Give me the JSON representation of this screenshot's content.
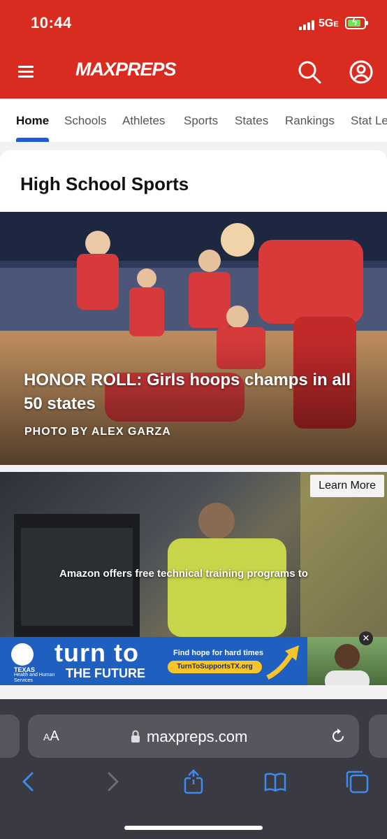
{
  "status_bar": {
    "time": "10:44",
    "network": "5G",
    "network_suffix": "E"
  },
  "app_header": {
    "logo_text": "MAXPREPS",
    "brand_color": "#d92c20",
    "menu_icon": "hamburger-menu-icon",
    "search_icon": "search-icon",
    "account_icon": "account-icon"
  },
  "nav_tabs": [
    {
      "label": "Home",
      "active": true
    },
    {
      "label": "Schools",
      "active": false
    },
    {
      "label": "Athletes",
      "active": false
    },
    {
      "label": "Sports",
      "active": false
    },
    {
      "label": "States",
      "active": false
    },
    {
      "label": "Rankings",
      "active": false
    },
    {
      "label": "Stat Le",
      "active": false
    }
  ],
  "main": {
    "section_title": "High School Sports",
    "hero": {
      "headline": "HONOR ROLL: Girls hoops champs in all 50 states",
      "credit": "PHOTO BY ALEX GARZA"
    }
  },
  "ad": {
    "learn_more": "Learn More",
    "caption": "Amazon offers free technical training programs to",
    "banner": {
      "seal_label_1": "TEXAS",
      "seal_label_2": "Health and Human",
      "seal_label_3": "Services",
      "headline_1": "turn to",
      "headline_2": "THE FUTURE",
      "tagline": "Find hope for hard times",
      "url": "TurnToSupportsTX.org"
    },
    "close": "✕"
  },
  "browser": {
    "text_size_label_small": "A",
    "text_size_label_large": "A",
    "url": "maxpreps.com"
  }
}
